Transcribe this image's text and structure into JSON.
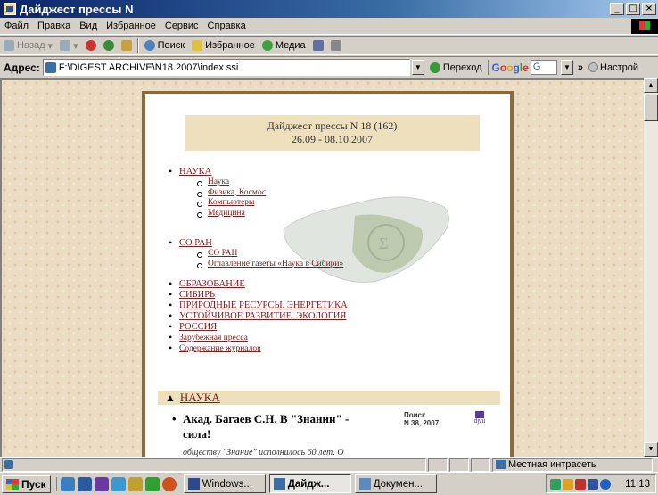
{
  "window": {
    "title": "Дайджест прессы N",
    "controls": [
      "_",
      "□",
      "×"
    ]
  },
  "menu": [
    "Файл",
    "Правка",
    "Вид",
    "Избранное",
    "Сервис",
    "Справка"
  ],
  "toolbar": {
    "back": "Назад",
    "search": "Поиск",
    "favorites": "Избранное",
    "media": "Медиа"
  },
  "address": {
    "label": "Адрес:",
    "url": "F:\\DIGEST ARCHIVE\\N18.2007\\index.ssi",
    "go": "Переход",
    "google_box": "G",
    "settings": "Настрой"
  },
  "page": {
    "header_line1": "Дайджест прессы N 18 (162)",
    "header_line2": "26.09 - 08.10.2007",
    "nav": {
      "nauka": "НАУКА",
      "nauka_sub": [
        "Наука",
        "Физика, Космос",
        "Компьютеры",
        "Медицина"
      ],
      "soran": "СО РАН",
      "soran_sub": [
        "СО РАН",
        "Оглавление газеты «Наука в Сибири»"
      ],
      "others": [
        "ОБРАЗОВАНИЕ",
        "СИБИРЬ",
        "ПРИРОДНЫЕ РЕСУРСЫ. ЭНЕРГЕТИКА",
        "УСТОЙЧИВОЕ РАЗВИТИЕ. ЭКОЛОГИЯ",
        "РОССИЯ",
        "Зарубежная пресса",
        "Содержание журналов"
      ]
    },
    "section_title": "НАУКА",
    "article": {
      "title": "Акад. Багаев С.Н. В \"Знании\" - сила!",
      "source_line1": "Поиск",
      "source_line2": "N 38, 2007",
      "pdf_label": "djvu",
      "lead": "обществу \"Знание\" исполнилось 60 лет. О"
    }
  },
  "status": {
    "zone": "Местная интрасеть"
  },
  "taskbar": {
    "start": "Пуск",
    "tasks": [
      "Windows...",
      "Дайдж...",
      "Докумен..."
    ],
    "clock": "11:13"
  }
}
